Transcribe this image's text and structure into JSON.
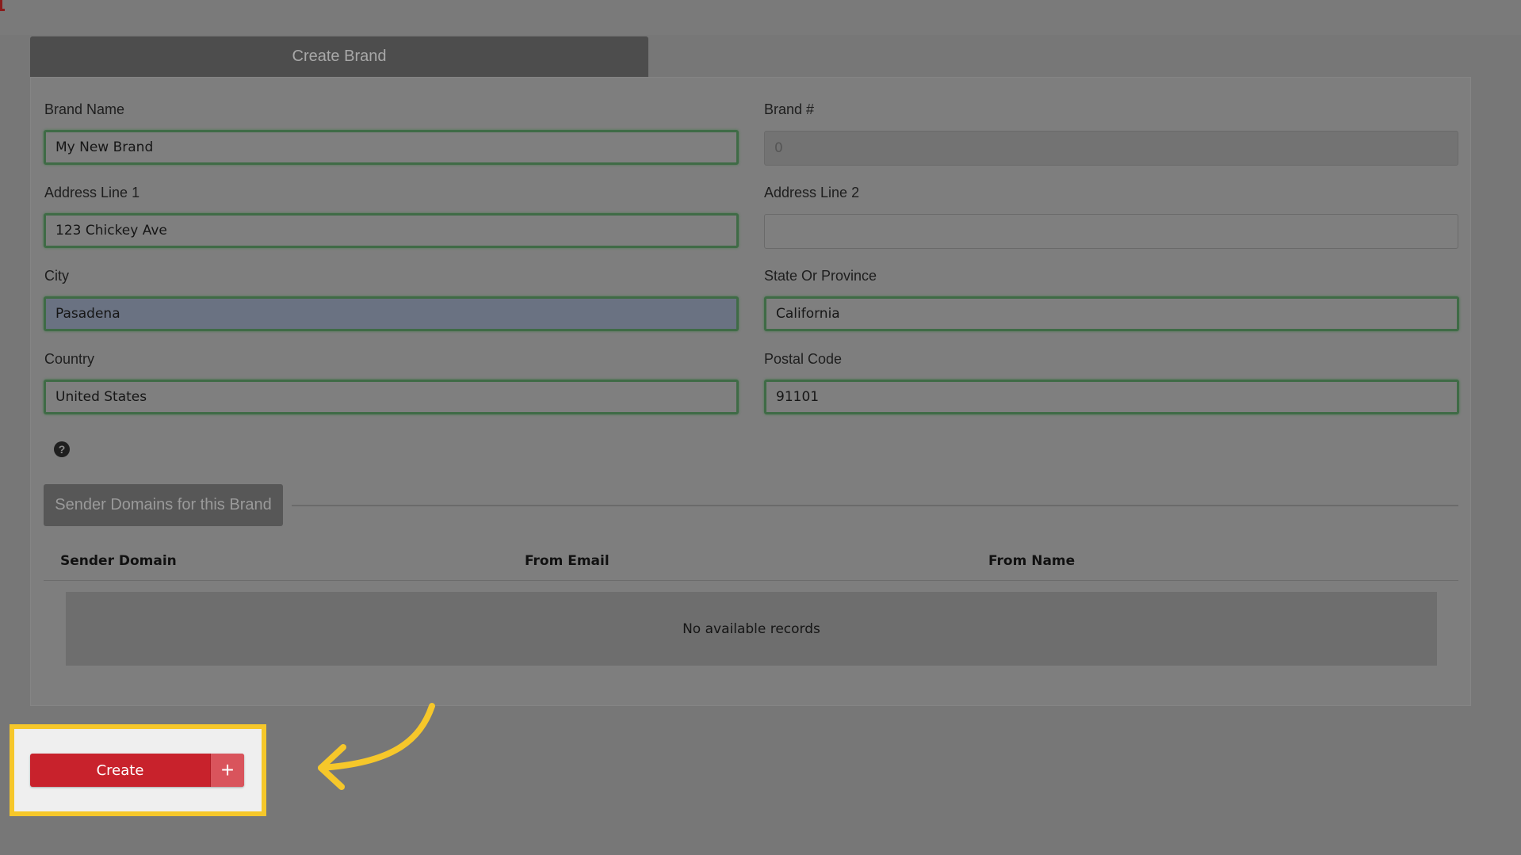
{
  "tab": {
    "title": "Create Brand"
  },
  "form": {
    "brand_name": {
      "label": "Brand Name",
      "value": "My New Brand"
    },
    "brand_number": {
      "label": "Brand #",
      "value": "0"
    },
    "address1": {
      "label": "Address Line 1",
      "value": "123 Chickey Ave"
    },
    "address2": {
      "label": "Address Line 2",
      "value": ""
    },
    "city": {
      "label": "City",
      "value": "Pasadena"
    },
    "state": {
      "label": "State Or Province",
      "value": "California"
    },
    "country": {
      "label": "Country",
      "value": "United States"
    },
    "postal": {
      "label": "Postal Code",
      "value": "91101"
    }
  },
  "help": {
    "glyph": "?"
  },
  "sender_section": {
    "title": "Sender Domains for this Brand",
    "columns": [
      "Sender Domain",
      "From Email",
      "From Name"
    ],
    "empty_text": "No available records"
  },
  "create_button": {
    "label": "Create",
    "icon": "+"
  },
  "colors": {
    "accent": "#c8222c",
    "highlight": "#f6c72a",
    "valid_border": "#3f6b46"
  }
}
